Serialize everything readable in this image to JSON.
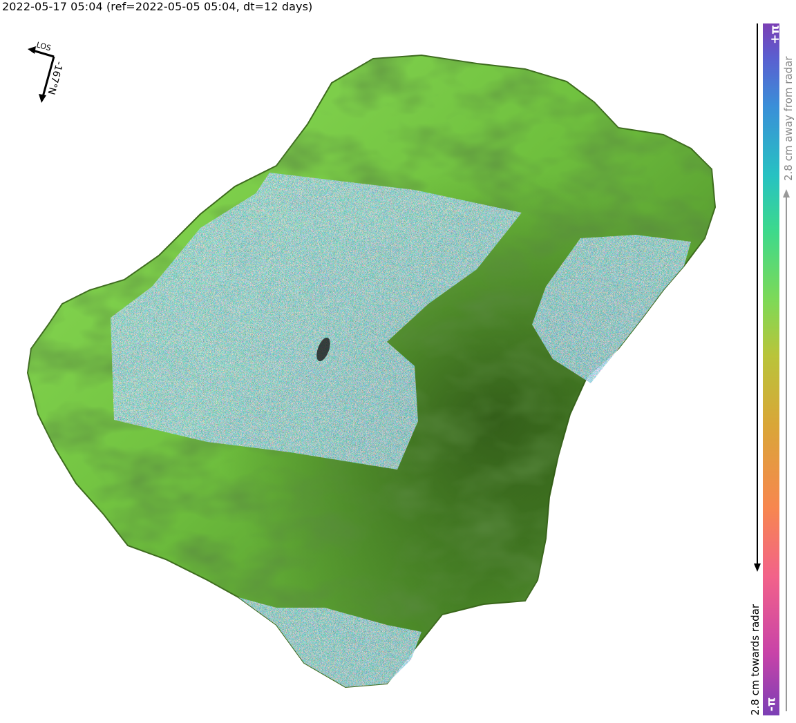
{
  "title": "2022-05-17 05:04 (ref=2022-05-05 05:04, dt=12 days)",
  "compass": {
    "los_label": "LOS",
    "heading_label": "-167°N"
  },
  "colorbar": {
    "top_label": "+π",
    "bottom_label": "-π",
    "away_label": "2.8 cm away from radar",
    "towards_label": "2.8 cm towards radar",
    "colors": [
      "#7b3fb5",
      "#c843a8",
      "#f2628a",
      "#f7874f",
      "#d9a638",
      "#b9c43a",
      "#7ed957",
      "#3dd98c",
      "#27c2c2",
      "#3a8fd8",
      "#5a5fd0",
      "#7b3fb5"
    ]
  },
  "map": {
    "terrain_color": "#78c84a",
    "terrain_shadow": "#3f6a20"
  }
}
